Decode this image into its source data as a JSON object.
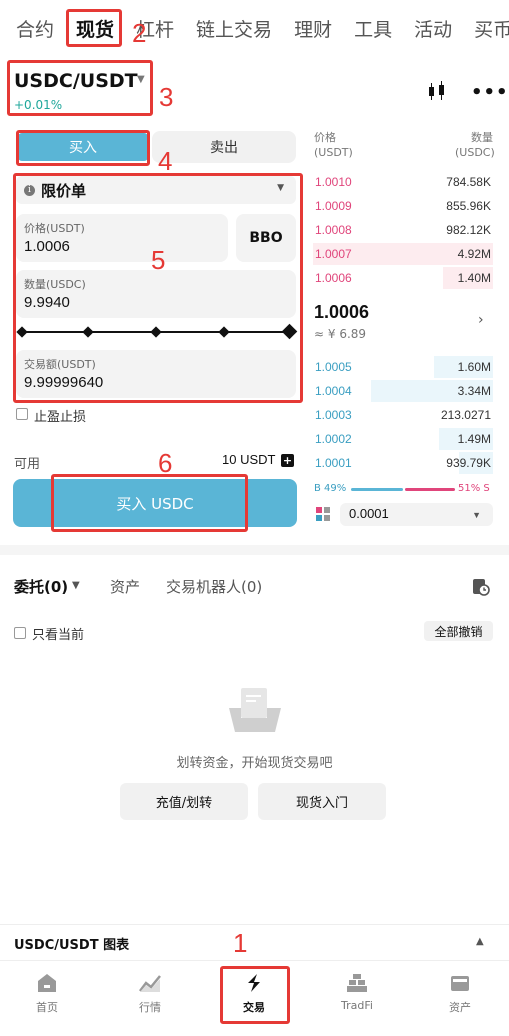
{
  "top_tabs": [
    "合约",
    "现货",
    "杠杆",
    "链上交易",
    "理财",
    "工具",
    "活动",
    "买币"
  ],
  "pair": {
    "symbol": "USDC/USDT",
    "change": "+0.01%"
  },
  "trade": {
    "buy_label": "买入",
    "sell_label": "卖出",
    "order_type": "限价单",
    "price_label": "价格(USDT)",
    "price_value": "1.0006",
    "bbo_label": "BBO",
    "qty_label": "数量(USDC)",
    "qty_value": "9.9940",
    "amount_label": "交易额(USDT)",
    "amount_value": "9.99999640",
    "tpsl_label": "止盈止损",
    "available_label": "可用",
    "available_value": "10 USDT",
    "buy_button": "买入 USDC"
  },
  "orderbook": {
    "price_header": "价格",
    "price_unit": "(USDT)",
    "qty_header": "数量",
    "qty_unit": "(USDC)",
    "asks": [
      {
        "price": "1.0010",
        "qty": "784.58K",
        "depth": 0.0
      },
      {
        "price": "1.0009",
        "qty": "855.96K",
        "depth": 0.0
      },
      {
        "price": "1.0008",
        "qty": "982.12K",
        "depth": 0.0
      },
      {
        "price": "1.0007",
        "qty": "4.92M",
        "depth": 1.0
      },
      {
        "price": "1.0006",
        "qty": "1.40M",
        "depth": 0.28
      }
    ],
    "mid_price": "1.0006",
    "mid_fiat": "≈ ¥ 6.89",
    "bids": [
      {
        "price": "1.0005",
        "qty": "1.60M",
        "depth": 0.33
      },
      {
        "price": "1.0004",
        "qty": "3.34M",
        "depth": 0.68
      },
      {
        "price": "1.0003",
        "qty": "213.0271",
        "depth": 0.0
      },
      {
        "price": "1.0002",
        "qty": "1.49M",
        "depth": 0.3
      },
      {
        "price": "1.0001",
        "qty": "939.79K",
        "depth": 0.19
      }
    ],
    "buy_ratio": "B 49%",
    "sell_ratio": "51% S",
    "precision": "0.0001"
  },
  "orders": {
    "tabs": [
      "委托(0)",
      "资产",
      "交易机器人(0)"
    ],
    "only_current": "只看当前",
    "cancel_all": "全部撤销",
    "empty_text": "划转资金，开始现货交易吧",
    "deposit_button": "充值/划转",
    "intro_button": "现货入门"
  },
  "chart_bar": {
    "title": "USDC/USDT 图表"
  },
  "nav": [
    "首页",
    "行情",
    "交易",
    "TradFi",
    "资产"
  ],
  "annotations": [
    "1",
    "2",
    "3",
    "4",
    "5",
    "6"
  ],
  "colors": {
    "accent": "#5ab5d6",
    "ask": "#e0457b",
    "bid": "#3a9ec1",
    "annotation": "#e53935"
  }
}
